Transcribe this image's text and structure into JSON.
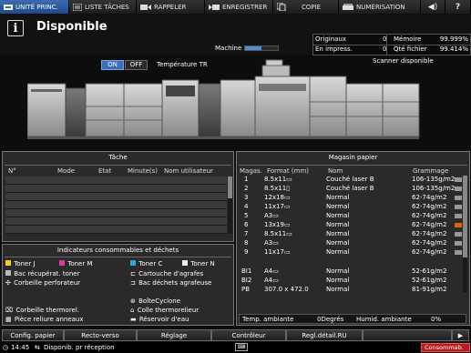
{
  "tabs": [
    {
      "label": "UNITÉ PRINC.",
      "active": true,
      "icon": "main-unit-icon"
    },
    {
      "label": "LISTE TÂCHES",
      "icon": "job-list-icon"
    },
    {
      "label": "RAPPELER",
      "icon": "recall-icon"
    },
    {
      "label": "ENREGISTRER",
      "icon": "register-icon"
    },
    {
      "label": "COPIE",
      "icon": "copy-icon"
    },
    {
      "label": "NUMÉRISATION",
      "icon": "scan-icon"
    }
  ],
  "header": {
    "status": "Disponible",
    "machine_label": "Machine",
    "machine_progress": 0.5
  },
  "counters": {
    "originals_label": "Originaux",
    "originals_value": "0",
    "memory_label": "Mémoire",
    "memory_value": "99.999%",
    "printing_label": "En impress.",
    "printing_value": "0",
    "file_label": "Qté fichier",
    "file_value": "99.414%"
  },
  "temperature": {
    "on_label": "ON",
    "off_label": "OFF",
    "label": "Température TR"
  },
  "scanner_status": "Scanner disponible",
  "task_panel": {
    "title": "Tâche",
    "columns": [
      "N°",
      "Mode",
      "Etat",
      "Minute(s)",
      "Nom utilisateur"
    ]
  },
  "consumables": {
    "title": "Indicateurs consommables et déchets",
    "items": [
      {
        "label": "Toner J",
        "icon": "toner-icon"
      },
      {
        "label": "Toner M",
        "icon": "toner-icon"
      },
      {
        "label": "Toner C",
        "icon": "toner-icon"
      },
      {
        "label": "Toner N",
        "icon": "toner-icon"
      },
      {
        "label": "Bac récupérat. toner",
        "icon": "waste-toner-icon"
      },
      {
        "label": "Cartouche d'agrafes",
        "icon": "staple-icon"
      },
      {
        "label": "Corbeille perforateur",
        "icon": "punch-icon"
      },
      {
        "label": "Bac déchets agrafeuse",
        "icon": "staple-waste-icon"
      },
      {
        "label": "BoîteCyclone",
        "icon": "cyclone-icon"
      },
      {
        "label": "Corbeille thermorel.",
        "icon": "trash-icon"
      },
      {
        "label": "Colle thermorelieur",
        "icon": "glue-icon"
      },
      {
        "label": "Pièce reliure anneaux",
        "icon": "ring-icon"
      },
      {
        "label": "Réservoir d'eau",
        "icon": "water-icon"
      }
    ]
  },
  "paper_panel": {
    "title": "Magasin papier",
    "columns": [
      "Magas.",
      "Format (mm)",
      "Nom",
      "Grammage"
    ],
    "trays": [
      {
        "id": "1",
        "format": "8.5x11▭",
        "name": "Couché laser B",
        "weight": "106-135g/m2",
        "level": 0.6
      },
      {
        "id": "2",
        "format": "8.5x11▯",
        "name": "Couché laser B",
        "weight": "106-135g/m2",
        "level": 0.6
      },
      {
        "id": "3",
        "format": "12x18▭",
        "name": "Normal",
        "weight": "62-74g/m2",
        "level": 0.6
      },
      {
        "id": "4",
        "format": "11x17▭",
        "name": "Normal",
        "weight": "62-74g/m2",
        "level": 0.6
      },
      {
        "id": "5",
        "format": "A3▭",
        "name": "Normal",
        "weight": "62-74g/m2",
        "level": 0.6
      },
      {
        "id": "6",
        "format": "13x19▭",
        "name": "Normal",
        "weight": "62-74g/m2",
        "level": 0,
        "alert": true
      },
      {
        "id": "7",
        "format": "8.5x11▭",
        "name": "Normal",
        "weight": "62-74g/m2",
        "level": 0.6
      },
      {
        "id": "8",
        "format": "A3▭",
        "name": "Normal",
        "weight": "62-74g/m2",
        "level": 0.6
      },
      {
        "id": "9",
        "format": "11x17▭",
        "name": "Normal",
        "weight": "62-74g/m2",
        "level": 0.6
      }
    ],
    "extra_trays": [
      {
        "id": "BI1",
        "format": "A4▭",
        "name": "Normal",
        "weight": "52-61g/m2"
      },
      {
        "id": "BI2",
        "format": "A4▭",
        "name": "Normal",
        "weight": "52-61g/m2"
      },
      {
        "id": "PB",
        "format": "307.0 x 472.0",
        "name": "Normal",
        "weight": "81-91g/m2"
      }
    ],
    "temp_label": "Temp. ambiante",
    "temp_value": "0Degrés",
    "humid_label": "Humid. ambiante",
    "humid_value": "0%"
  },
  "bottom_buttons": [
    "Config. papier",
    "Recto-verso",
    "Réglage",
    "Contrôleur",
    "Regl.détail.RU"
  ],
  "status_bar": {
    "time": "14:45",
    "message": "Disponib. pr réception",
    "consumables": "Consommab."
  }
}
